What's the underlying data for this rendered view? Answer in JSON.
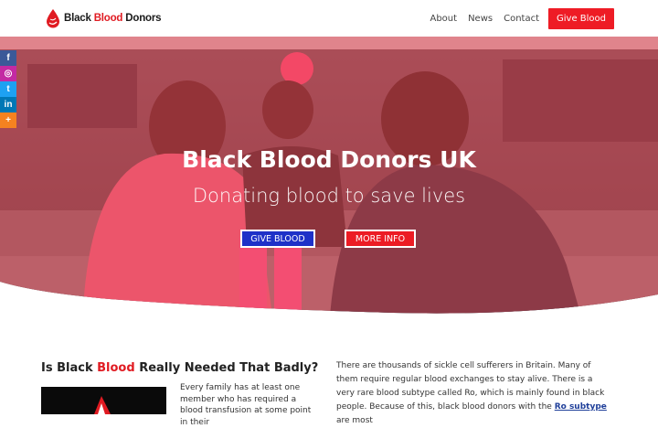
{
  "header": {
    "logo_part1": "Black ",
    "logo_part2": "Blood",
    "logo_part3": " Donors",
    "nav": [
      "About",
      "News",
      "Contact"
    ],
    "cta": "Give Blood"
  },
  "hero": {
    "title": "Black Blood Donors UK",
    "subtitle": "Donating blood to save lives",
    "button_give": "GIVE BLOOD",
    "button_more": "MORE INFO"
  },
  "social": {
    "items": [
      {
        "icon": "facebook-icon",
        "glyph": "f",
        "color": "#3b5998"
      },
      {
        "icon": "instagram-icon",
        "glyph": "◎",
        "color": "#c32aa3"
      },
      {
        "icon": "twitter-icon",
        "glyph": "t",
        "color": "#1da1f2"
      },
      {
        "icon": "linkedin-icon",
        "glyph": "in",
        "color": "#0077b5"
      },
      {
        "icon": "more-icon",
        "glyph": "+",
        "color": "#f58220"
      }
    ]
  },
  "content": {
    "heading_pre": "Is Black ",
    "heading_red": "Blood",
    "heading_post": " Really Needed That Badly?",
    "left_text": "Every family has at least one member who has required a blood transfusion at some point in their",
    "right_text_1": "There are thousands of sickle cell sufferers in Britain. Many of them require regular blood exchanges to stay alive. There is a very rare blood subtype called Ro, which is mainly found in black people. Because of this, black blood donors with the ",
    "right_link": "Ro subtype",
    "right_text_2": " are most"
  },
  "colors": {
    "brand_red": "#ee1c25",
    "brand_blue": "#1e31c8",
    "hero_overlay": "#e8434f"
  }
}
